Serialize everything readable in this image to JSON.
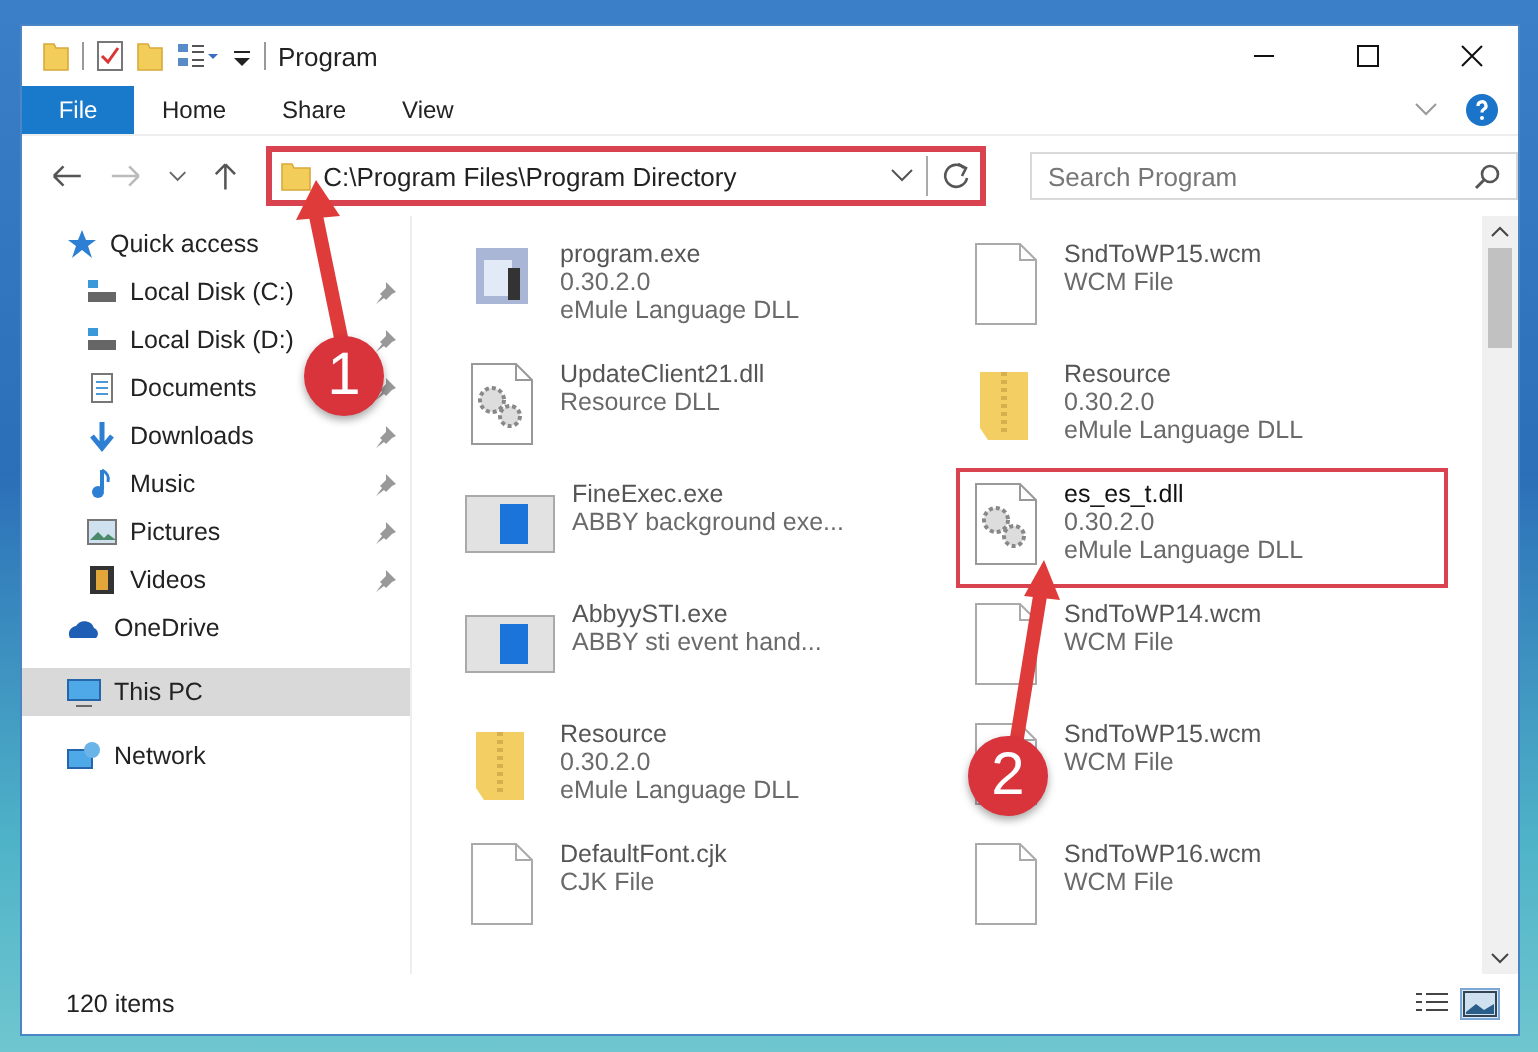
{
  "window": {
    "title": "Program"
  },
  "ribbon_tabs": [
    {
      "label": "File",
      "kind": "file",
      "selected": false
    },
    {
      "label": "Home",
      "kind": "tab",
      "selected": false
    },
    {
      "label": "Share",
      "kind": "tab",
      "selected": false
    },
    {
      "label": "View",
      "kind": "tab",
      "selected": false
    }
  ],
  "address": {
    "value": "C:\\Program Files\\Program Directory",
    "highlighted": true
  },
  "search": {
    "placeholder": "Search Program"
  },
  "sidebar": {
    "items": [
      {
        "label": "Quick access",
        "kind": "star",
        "selected": false,
        "children": [
          {
            "label": "Local Disk (C:)",
            "kind": "drive",
            "selected": false,
            "pinned": true
          },
          {
            "label": "Local Disk (D:)",
            "kind": "drive",
            "selected": false,
            "pinned": true
          },
          {
            "label": "Documents",
            "kind": "doc",
            "selected": false,
            "pinned": true
          },
          {
            "label": "Downloads",
            "kind": "download",
            "selected": false,
            "pinned": true
          },
          {
            "label": "Music",
            "kind": "music",
            "selected": false,
            "pinned": true
          },
          {
            "label": "Pictures",
            "kind": "pictures",
            "selected": false,
            "pinned": true
          },
          {
            "label": "Videos",
            "kind": "video",
            "selected": false,
            "pinned": true
          }
        ]
      },
      {
        "label": "OneDrive",
        "kind": "cloud",
        "selected": false
      },
      {
        "label": "This PC",
        "kind": "pc",
        "selected": true
      },
      {
        "label": "Network",
        "kind": "network",
        "selected": false
      }
    ]
  },
  "files": [
    {
      "name": "program.exe",
      "details": [
        "0.30.2.0",
        "eMule Language DLL"
      ],
      "kind": "app",
      "highlighted": false
    },
    {
      "name": "SndToWP15.wcm",
      "details": [
        "WCM File"
      ],
      "kind": "doc",
      "highlighted": false
    },
    {
      "name": "UpdateClient21.dll",
      "details": [
        "Resource DLL"
      ],
      "kind": "gear",
      "highlighted": false
    },
    {
      "name": "Resource",
      "details": [
        "0.30.2.0",
        "eMule Language DLL"
      ],
      "kind": "folder",
      "highlighted": false
    },
    {
      "name": "FineExec.exe",
      "details": [
        "ABBY background exe..."
      ],
      "kind": "window",
      "highlighted": false
    },
    {
      "name": "es_es_t.dll",
      "details": [
        "0.30.2.0",
        "eMule Language DLL"
      ],
      "kind": "gear",
      "highlighted": true
    },
    {
      "name": "AbbyySTI.exe",
      "details": [
        "ABBY sti event hand..."
      ],
      "kind": "window",
      "highlighted": false
    },
    {
      "name": "SndToWP14.wcm",
      "details": [
        "WCM File"
      ],
      "kind": "doc",
      "highlighted": false
    },
    {
      "name": "Resource",
      "details": [
        "0.30.2.0",
        "eMule Language DLL"
      ],
      "kind": "folder",
      "highlighted": false
    },
    {
      "name": "SndToWP15.wcm",
      "details": [
        "WCM File"
      ],
      "kind": "doc",
      "highlighted": false
    },
    {
      "name": "DefaultFont.cjk",
      "details": [
        "CJK File"
      ],
      "kind": "doc",
      "highlighted": false
    },
    {
      "name": "SndToWP16.wcm",
      "details": [
        "WCM File"
      ],
      "kind": "doc",
      "highlighted": false
    }
  ],
  "status_bar": {
    "count": "120 items",
    "views": [
      {
        "kind": "details",
        "selected": false
      },
      {
        "kind": "large",
        "selected": true
      }
    ]
  },
  "callouts": [
    {
      "number": "1"
    },
    {
      "number": "2"
    }
  ]
}
